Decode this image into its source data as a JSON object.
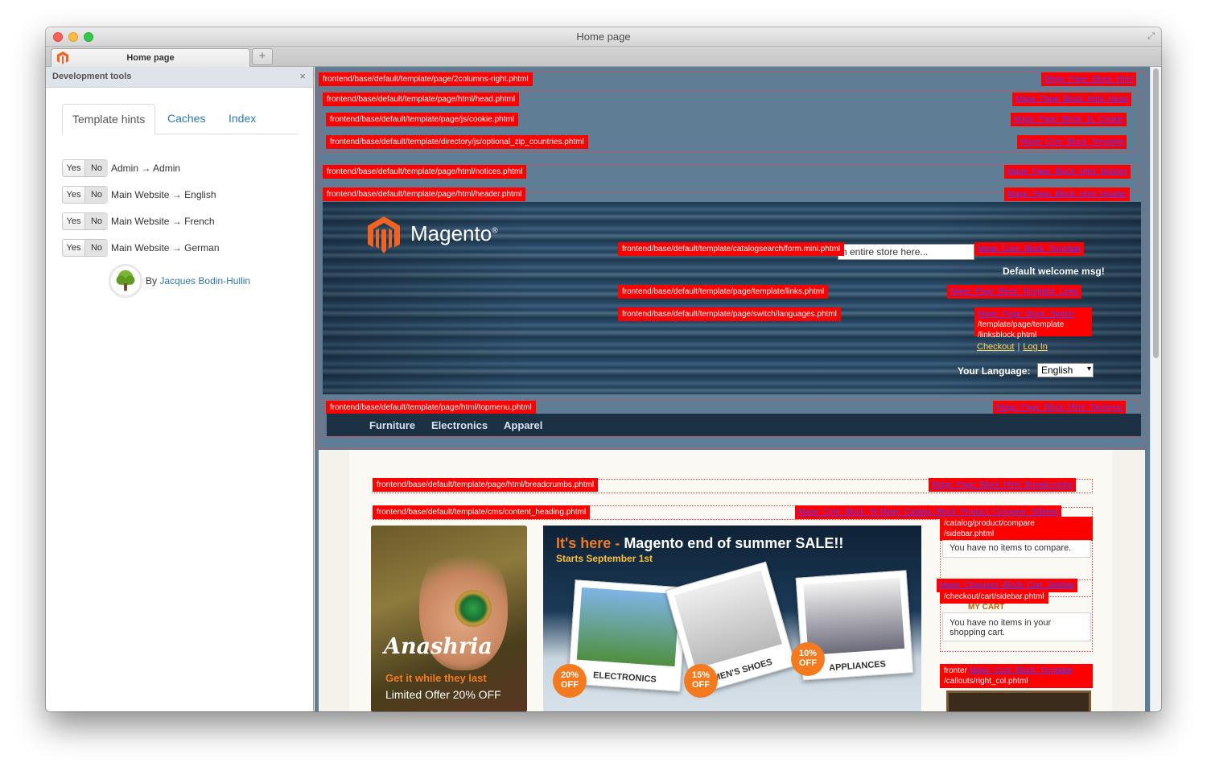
{
  "window": {
    "title": "Home page"
  },
  "browser": {
    "tab_label": "Home page",
    "new_tab_symbol": "+"
  },
  "sidebar": {
    "title": "Development tools",
    "close_symbol": "×",
    "tabs": [
      {
        "label": "Template hints",
        "active": true
      },
      {
        "label": "Caches",
        "active": false
      },
      {
        "label": "Index",
        "active": false
      }
    ],
    "rows": [
      {
        "yes": "Yes",
        "no": "No",
        "label": "Admin → Admin"
      },
      {
        "yes": "Yes",
        "no": "No",
        "label": "Main Website → English"
      },
      {
        "yes": "Yes",
        "no": "No",
        "label": "Main Website → French"
      },
      {
        "yes": "Yes",
        "no": "No",
        "label": "Main Website → German"
      }
    ],
    "author_prefix": "By",
    "author_name": "Jacques Bodin-Hullin"
  },
  "hints": {
    "page_tpl": "frontend/base/default/template/page/2columns-right.phtml",
    "page_blk": "Mage_Page_Block_Html",
    "head_tpl": "frontend/base/default/template/page/html/head.phtml",
    "head_blk": "Mage_Page_Block_Html_Head",
    "cookie_tpl": "frontend/base/default/template/page/js/cookie.phtml",
    "cookie_blk": "Mage_Page_Block_Js_Cookie",
    "zip_tpl": "frontend/base/default/template/directory/js/optional_zip_countries.phtml",
    "zip_blk": "Mage_Core_Block_Template",
    "notices_tpl": "frontend/base/default/template/page/html/notices.phtml",
    "notices_blk": "Mage_Page_Block_Html_Notices",
    "header_tpl": "frontend/base/default/template/page/html/header.phtml",
    "header_blk": "Mage_Page_Block_Html_Header",
    "search_tpl": "frontend/base/default/template/catalogsearch/form.mini.phtml",
    "search_blk": "Mage_Core_Block_Template",
    "links_tpl": "frontend/base/default/template/page/template/links.phtml",
    "links_blk": "Mage_Page_Block_Template_Links",
    "lang_tpl": "frontend/base/default/template/page/switch/languages.phtml",
    "lang_blk": "Mage_Page_Block_Switch",
    "linksblock_tpl1": "/template/page/template",
    "linksblock_tpl2": "/linksblock.phtml",
    "topmenu_tpl": "frontend/base/default/template/page/html/topmenu.phtml",
    "topmenu_blk": "Mage_Page_Block_Html_Topmenu",
    "breadcrumbs_tpl": "frontend/base/default/template/page/html/breadcrumbs.phtml",
    "breadcrumbs_blk": "Mage_Page_Block_Html_Breadcrumbs",
    "content_tpl": "frontend/base/default/template/cms/content_heading.phtml",
    "compare_blk": "Mage_Core_Block_Te Mage_Catalog_Block_Product_Compare_Sidebar",
    "compare_tpl1": "/catalog/product/compare",
    "compare_tpl2": "/sidebar.phtml",
    "cart_blk": "Mage_Checkout_Block_Cart_Sidebar",
    "cart_tpl": "/checkout/cart/sidebar.phtml",
    "callout_prefix": "fronter",
    "callout_blk": "Mage_Core_Block_Template",
    "callout_tpl": "/callouts/right_col.phtml"
  },
  "store": {
    "logo_text": "Magento",
    "logo_reg": "®",
    "search_placeholder": "h entire store here...",
    "welcome": "Default welcome msg!",
    "link_checkout": "Checkout",
    "link_separator": "|",
    "link_login": "Log In",
    "language_label": "Your Language:",
    "language_value": "English",
    "nav": [
      "Furniture",
      "Electronics",
      "Apparel"
    ]
  },
  "banners": {
    "left_brand": "Anashria",
    "left_tagline": "Get it while they last",
    "left_offer": "Limited Offer 20% OFF",
    "main_title_highlight": "It's here - ",
    "main_title_rest": "Magento end of summer SALE!!",
    "main_subtitle": "Starts September 1st",
    "products": [
      {
        "caption": "ELECTRONICS",
        "discount": "20%\nOFF"
      },
      {
        "caption": "MEN'S SHOES",
        "discount": "15%\nOFF"
      },
      {
        "caption": "APPLIANCES",
        "discount": "10%\nOFF"
      }
    ]
  },
  "side": {
    "compare_empty": "You have no items to compare.",
    "cart_heading": "MY CART",
    "cart_empty": "You have no items in your shopping cart."
  },
  "colors": {
    "hint_red": "#ff0000",
    "magento_orange": "#f47a20",
    "link_blue": "#2a7ab8"
  }
}
